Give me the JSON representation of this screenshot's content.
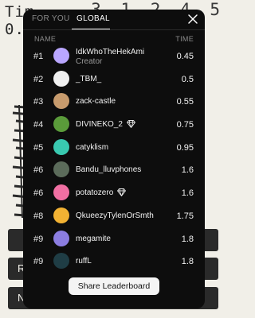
{
  "background": {
    "title_line1": "Tim",
    "title_line2": "0.",
    "digits": "3 1 2 4 5",
    "buttons": [
      "",
      "R",
      "N"
    ]
  },
  "leaderboard": {
    "tabs": [
      "FOR YOU",
      "GLOBAL"
    ],
    "active_tab": "GLOBAL",
    "columns": {
      "name": "NAME",
      "time": "TIME"
    },
    "rows": [
      {
        "rank": "#1",
        "name": "IdkWhoTheHekAmi",
        "subtitle": "Creator",
        "time": "0.45",
        "badge": false,
        "avatar_color": "#b9a6ff"
      },
      {
        "rank": "#2",
        "name": "_TBM_",
        "subtitle": "",
        "time": "0.5",
        "badge": false,
        "avatar_color": "#f0f0f0"
      },
      {
        "rank": "#3",
        "name": "zack-castle",
        "subtitle": "",
        "time": "0.55",
        "badge": false,
        "avatar_color": "#c79b6d"
      },
      {
        "rank": "#4",
        "name": "DIVINEKO_2",
        "subtitle": "",
        "time": "0.75",
        "badge": true,
        "avatar_color": "#5a9b3a"
      },
      {
        "rank": "#5",
        "name": "catyklism",
        "subtitle": "",
        "time": "0.95",
        "badge": false,
        "avatar_color": "#39c9b0"
      },
      {
        "rank": "#6",
        "name": "Bandu_lluvphones",
        "subtitle": "",
        "time": "1.6",
        "badge": false,
        "avatar_color": "#5b6b5a"
      },
      {
        "rank": "#6",
        "name": "potatozero",
        "subtitle": "",
        "time": "1.6",
        "badge": true,
        "avatar_color": "#f06fa2"
      },
      {
        "rank": "#8",
        "name": "QkueezyTylenOrSmth",
        "subtitle": "",
        "time": "1.75",
        "badge": false,
        "avatar_color": "#f2b233"
      },
      {
        "rank": "#9",
        "name": "megamite",
        "subtitle": "",
        "time": "1.8",
        "badge": false,
        "avatar_color": "#8b7de0"
      },
      {
        "rank": "#9",
        "name": "ruffL",
        "subtitle": "",
        "time": "1.8",
        "badge": false,
        "avatar_color": "#1f3d45"
      }
    ],
    "share_label": "Share Leaderboard"
  }
}
